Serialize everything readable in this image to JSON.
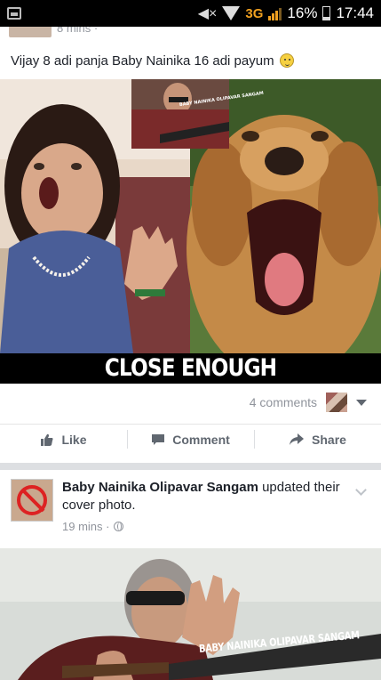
{
  "status_bar": {
    "network": "3G",
    "battery_percent": "16%",
    "time": "17:44",
    "signal_level": 0.8,
    "battery_level": 0.16
  },
  "post1": {
    "time_partial": "8 mins · ",
    "text": "Vijay 8 adi panja Baby Nainika 16 adi payum",
    "emoji": "smiley-icon",
    "image_caption": "CLOSE ENOUGH",
    "image_banner": "BABY NAINIKA OLIPAVAR SANGAM",
    "comments": "4 comments",
    "actions": {
      "like": "Like",
      "comment": "Comment",
      "share": "Share"
    }
  },
  "post2": {
    "page_name": "Baby Nainika Olipavar Sangam",
    "activity": "updated their cover photo.",
    "time": "19 mins · ",
    "cover_banner": "BABY NAINIKA OLIPAVAR SANGAM"
  },
  "colors": {
    "facebook_text": "#1d2129",
    "secondary_text": "#90949c",
    "action_text": "#606770",
    "network_accent": "#f0a020"
  }
}
